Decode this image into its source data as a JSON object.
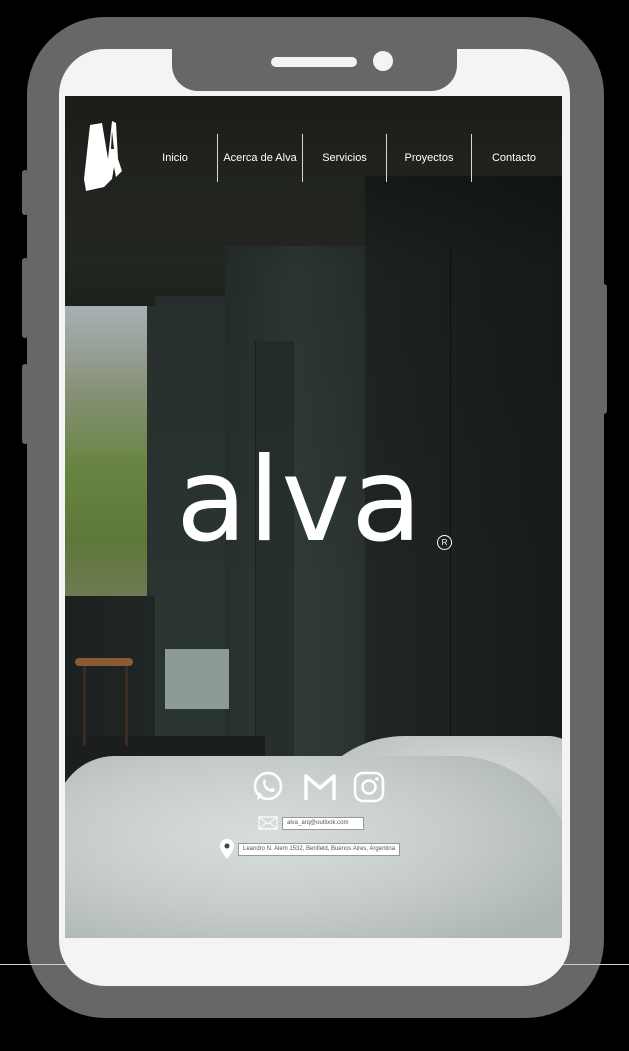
{
  "nav": {
    "items": [
      {
        "label": "Inicio"
      },
      {
        "label": "Acerca de Alva"
      },
      {
        "label": "Servicios"
      },
      {
        "label": "Proyectos"
      },
      {
        "label": "Contacto"
      }
    ]
  },
  "hero": {
    "brand": "alva",
    "registered_mark": "R"
  },
  "social": {
    "icons": [
      "whatsapp-icon",
      "gmail-icon",
      "instagram-icon"
    ]
  },
  "contact": {
    "email": "alva_arq@outlook.com",
    "address": "Leandro N. Alem 1532, Benfield, Buenos Aires, Argentina"
  },
  "colors": {
    "frame": "#676767",
    "screen": "#f4f4f4",
    "text": "#ffffff"
  }
}
